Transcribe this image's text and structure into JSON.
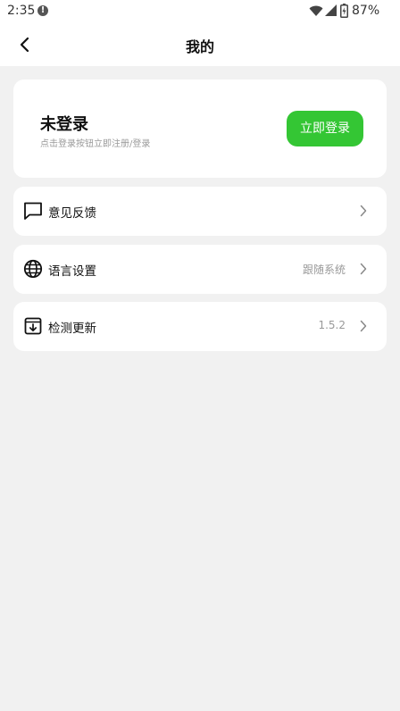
{
  "status_bar": {
    "time": "2:35",
    "alert_icon": "alert-circle-icon",
    "wifi_icon": "wifi-icon",
    "signal_icon": "signal-icon",
    "battery_icon": "battery-icon",
    "battery_percent": "87%"
  },
  "header": {
    "back_icon": "chevron-left-icon",
    "title": "我的"
  },
  "login_card": {
    "title": "未登录",
    "subtitle": "点击登录按钮立即注册/登录",
    "button_label": "立即登录",
    "button_color": "#34c634"
  },
  "menu": [
    {
      "label": "意见反馈",
      "value": "",
      "icon": "chat-bubble-icon"
    },
    {
      "label": "语言设置",
      "value": "跟随系统",
      "icon": "globe-icon"
    },
    {
      "label": "检测更新",
      "value": "1.5.2",
      "icon": "download-box-icon"
    }
  ],
  "colors": {
    "background": "#f1f1f1",
    "card": "#ffffff",
    "accent": "#34c634"
  }
}
